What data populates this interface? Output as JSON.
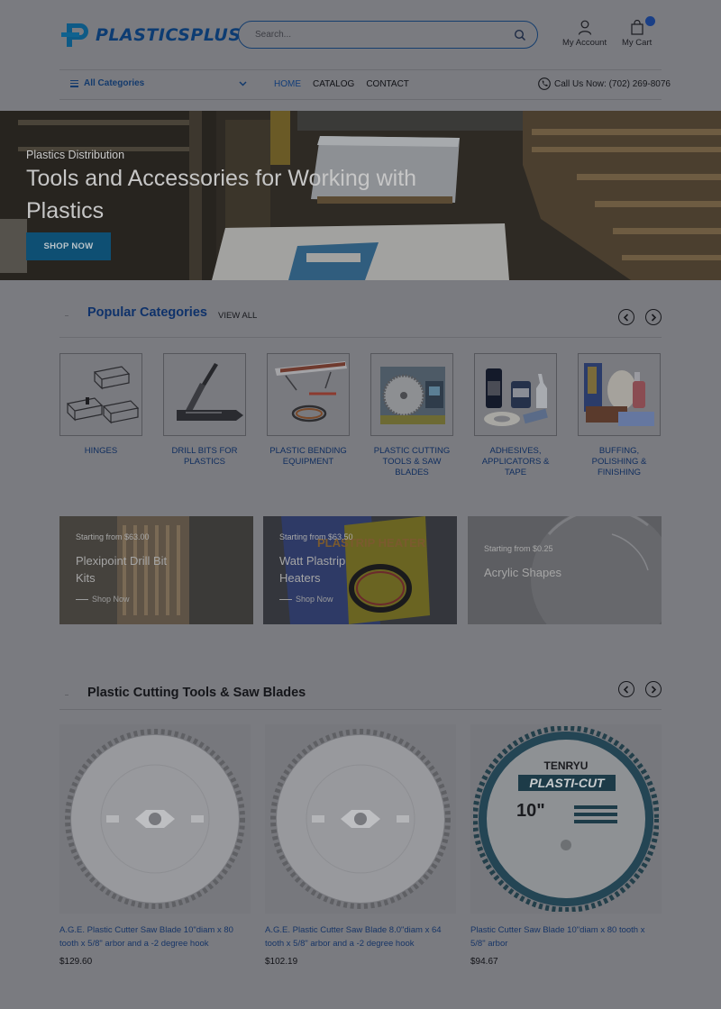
{
  "brand": {
    "name": "PLASTICSPLUS"
  },
  "search": {
    "placeholder": "Search..."
  },
  "header": {
    "account_label": "My Account",
    "cart_label": "My Cart"
  },
  "nav": {
    "all_categories": "All Categories",
    "menu": [
      {
        "label": "HOME",
        "active": true
      },
      {
        "label": "CATALOG",
        "active": false
      },
      {
        "label": "CONTACT",
        "active": false
      }
    ],
    "call": "Call Us Now: (702) 269-8076"
  },
  "hero": {
    "eyebrow": "Plastics Distribution",
    "title": "Tools and Accessories for Working with Plastics",
    "button": "SHOP NOW"
  },
  "popular": {
    "title": "Popular Categories",
    "view_all": "VIEW ALL",
    "categories": [
      {
        "label": "HINGES",
        "icon": "hinges-image"
      },
      {
        "label": "DRILL BITS FOR PLASTICS",
        "icon": "drill-bits-image"
      },
      {
        "label": "PLASTIC BENDING EQUIPMENT",
        "icon": "bending-equipment-image"
      },
      {
        "label": "PLASTIC CUTTING TOOLS & SAW BLADES",
        "icon": "saw-blades-image"
      },
      {
        "label": "ADHESIVES, APPLICATORS & TAPE",
        "icon": "adhesives-image"
      },
      {
        "label": "BUFFING, POLISHING & FINISHING",
        "icon": "buffing-image"
      }
    ]
  },
  "promos": [
    {
      "starting": "Starting from $63.00",
      "title": "Plexipoint Drill Bit Kits",
      "shop": "Shop Now"
    },
    {
      "starting": "Starting from $63.50",
      "title": "Watt Plastrip Heaters",
      "shop": "Shop Now"
    },
    {
      "starting": "Starting from $0.25",
      "title": "Acrylic Shapes",
      "shop": ""
    }
  ],
  "products_section": {
    "title": "Plastic Cutting Tools & Saw Blades",
    "items": [
      {
        "name": "A.G.E. Plastic Cutter Saw Blade 10\"diam x 80 tooth x 5/8\" arbor and a -2 degree hook",
        "price": "$129.60"
      },
      {
        "name": "A.G.E. Plastic Cutter Saw Blade 8.0\"diam x 64 tooth x 5/8\" arbor and a -2 degree hook",
        "price": "$102.19"
      },
      {
        "name": "Plastic Cutter Saw Blade 10\"diam x 80 tooth x 5/8\" arbor",
        "price": "$94.67"
      }
    ],
    "tenryu_blade": {
      "brand": "TENRYU",
      "line": "PLASTI-CUT",
      "size": "10\""
    }
  },
  "colors": {
    "page_overlay": "#7a7b80",
    "brand_navy": "#0d3c72",
    "accent_blue": "#0e4f73",
    "badge": "#1a3f86"
  }
}
